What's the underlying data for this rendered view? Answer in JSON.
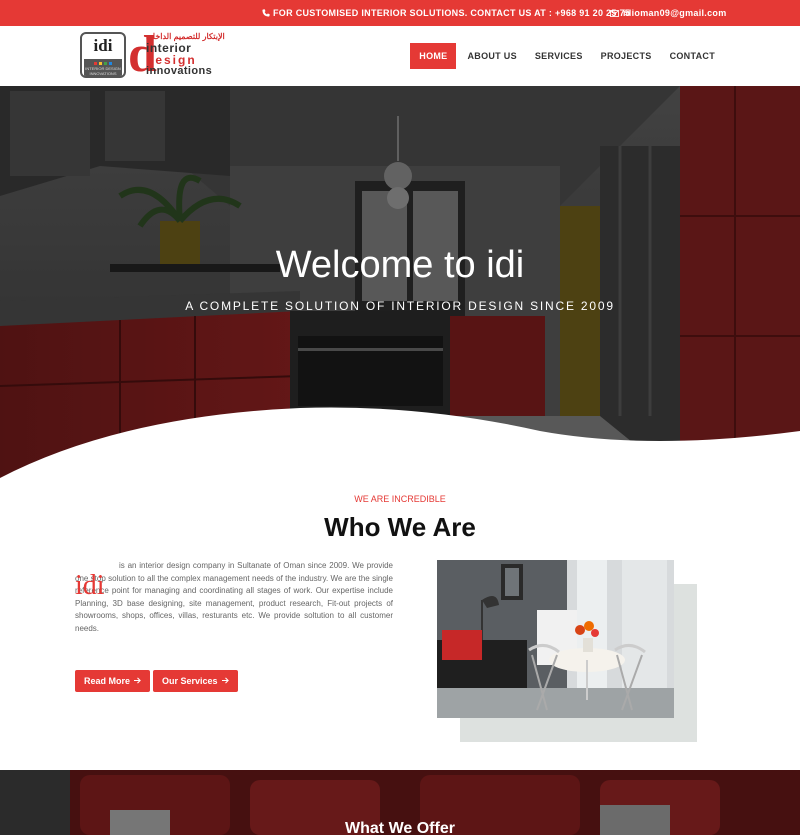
{
  "topbar": {
    "contact_text": "FOR CUSTOMISED INTERIOR SOLUTIONS. CONTACT US AT : +968 91 20 25 75",
    "email": "idioman09@gmail.com",
    "phone_icon": "phone-icon",
    "email_icon": "envelope-icon",
    "color": "#e53935"
  },
  "logo": {
    "badge_text": "idi",
    "badge_sub": "INTERIOR DESIGN INNOVATIONS",
    "big_letter": "d",
    "arabic": "الإبتكار للتصميم الداخلي",
    "word1": "interior",
    "word2": "design",
    "word3": "innovations"
  },
  "nav": {
    "items": [
      {
        "label": "HOME",
        "active": true
      },
      {
        "label": "ABOUT US",
        "active": false
      },
      {
        "label": "SERVICES",
        "active": false
      },
      {
        "label": "PROJECTS",
        "active": false
      },
      {
        "label": "CONTACT",
        "active": false
      }
    ]
  },
  "hero": {
    "title": "Welcome to idi",
    "subtitle": "A COMPLETE SOLUTION OF INTERIOR DESIGN SINCE 2009"
  },
  "about": {
    "eyebrow": "WE ARE INCREDIBLE",
    "title": "Who We Are",
    "mark": "idi",
    "text": "is an interior design company in Sultanate of Oman since 2009. We provide one stop solution to all the complex management needs of the industry. We are the single reference point for managing and coordinating all stages of work. Our expertise include Planning, 3D base designing, site management, product research, Fit-out projects of showrooms, shops, offices, villas, resturants etc. We provide soltution to all customer needs.",
    "read_more": "Read More",
    "our_services": "Our Services",
    "arrow_icon": "arrow-right-icon"
  },
  "offer": {
    "title": "What We Offer"
  }
}
